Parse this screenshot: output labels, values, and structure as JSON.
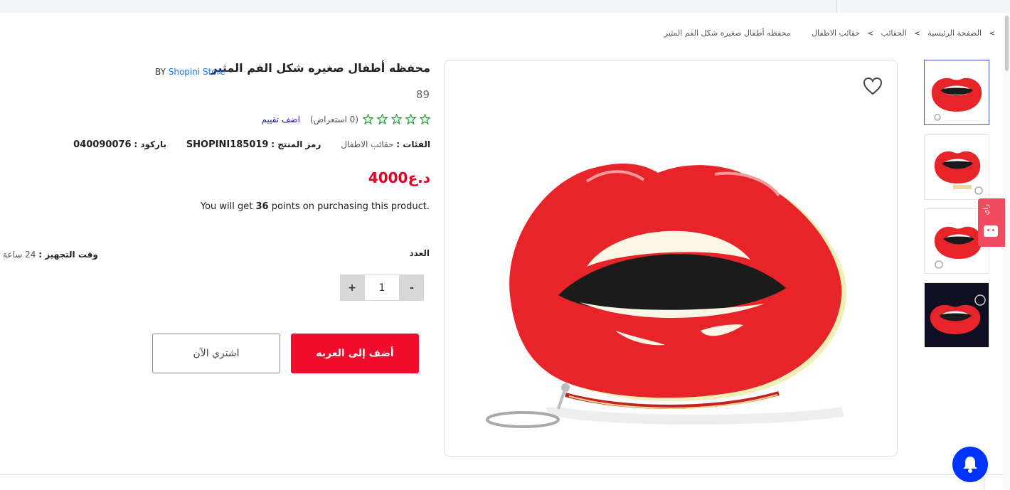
{
  "breadcrumb": {
    "items": [
      "الصفحة الرئيسية",
      "الحقائب",
      "حقائب الاطفال",
      "محفظه أطفال صغيره شكل الفم المثير"
    ],
    "separator": ">"
  },
  "product": {
    "title": "محفظه أطفال صغيره شكل الفم المثير",
    "by_label": "BY",
    "store": "Shopini Store",
    "sku_number": "89",
    "rating": {
      "stars_filled": 0,
      "stars_total": 5,
      "reviews_text": "(0 استعراض)",
      "add_review": "اضف تقييم"
    },
    "meta": {
      "categories_label": "الفئات :",
      "categories_value": "حقائب الاطفال",
      "code_label": "رمز المنتج :",
      "code_value": "SHOPINI185019",
      "barcode_label": "باركود :",
      "barcode_value": "040090076"
    },
    "price": "د.ع4000",
    "points": {
      "prefix": "You will get ",
      "number": "36",
      "suffix": " points on purchasing this product."
    },
    "quantity_label": "العدد",
    "prep_label": "وقت التجهيز :",
    "prep_value": "24 ساعة",
    "quantity": {
      "minus": "-",
      "value": "1",
      "plus": "+"
    },
    "add_to_cart": "أضف إلى العربه",
    "buy_now": "اشتري الآن"
  },
  "side_tab": {
    "label": "راي"
  },
  "icons": {
    "wishlist": "heart-icon",
    "notifications": "bell-icon",
    "rating": "star-outline-icon"
  },
  "colors": {
    "accent_red": "#f20c2c",
    "price_red": "#e60023",
    "link_blue": "#1a73e8",
    "star_green": "#2a9d3a",
    "bell_blue": "#0033ff",
    "side_tab": "#ef4a5d"
  }
}
